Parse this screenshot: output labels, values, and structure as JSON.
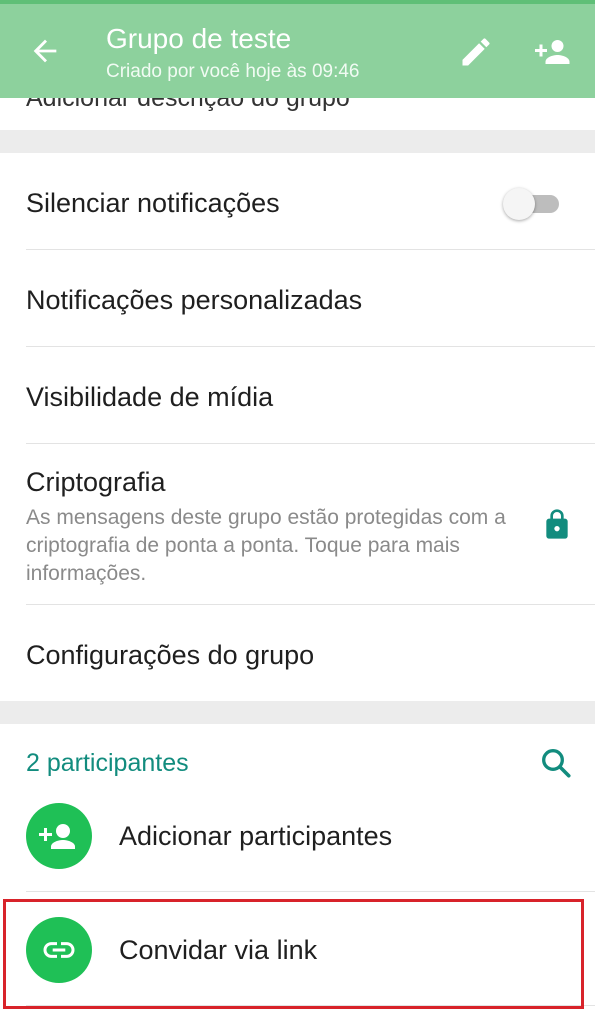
{
  "header": {
    "title": "Grupo de teste",
    "subtitle": "Criado por você hoje às 09:46"
  },
  "description_peek": "Adicionar descrição do grupo",
  "settings": {
    "mute": {
      "label": "Silenciar notificações",
      "enabled": false
    },
    "custom_notifications": {
      "label": "Notificações personalizadas"
    },
    "media_visibility": {
      "label": "Visibilidade de mídia"
    },
    "encryption": {
      "label": "Criptografia",
      "description": "As mensagens deste grupo estão protegidas com a criptografia de ponta a ponta. Toque para mais informações."
    },
    "group_settings": {
      "label": "Configurações do grupo"
    }
  },
  "participants": {
    "count_label": "2 participantes",
    "add_label": "Adicionar participantes",
    "invite_label": "Convidar via link"
  },
  "colors": {
    "app_bar": "#8dd19d",
    "accent_teal": "#128c7e",
    "avatar_green": "#1fc056",
    "highlight_red": "#d8232a"
  },
  "icons": [
    "back-arrow-icon",
    "edit-pencil-icon",
    "add-person-icon",
    "lock-icon",
    "search-icon",
    "link-icon"
  ]
}
